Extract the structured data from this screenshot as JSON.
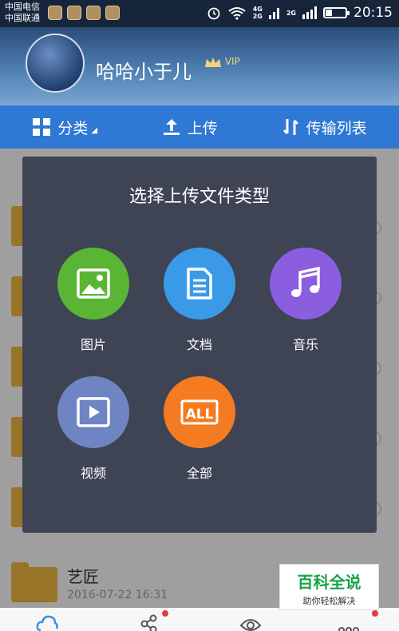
{
  "status": {
    "carrier1": "中国电信",
    "carrier2": "中国联通",
    "net1": "4G",
    "net2": "2G",
    "net3": "2G",
    "time": "20:15"
  },
  "header": {
    "username": "哈哈小于儿",
    "vip": "VIP"
  },
  "tabs": {
    "category": "分类",
    "upload": "上传",
    "transfer": "传输列表"
  },
  "list": {
    "rows": [
      {
        "name": "艺匠",
        "date": "2016-07-22  16:31"
      }
    ]
  },
  "dialog": {
    "title": "选择上传文件类型",
    "options": [
      {
        "label": "图片",
        "color": "#5ab535",
        "icon": "image-icon"
      },
      {
        "label": "文档",
        "color": "#3b9ae8",
        "icon": "document-icon"
      },
      {
        "label": "音乐",
        "color": "#8b5ee0",
        "icon": "music-icon"
      },
      {
        "label": "视频",
        "color": "#6f84c2",
        "icon": "video-icon"
      },
      {
        "label": "全部",
        "color": "#f57b22",
        "icon": "all-icon",
        "icon_text": "ALL"
      }
    ]
  },
  "watermark": {
    "title": "百科全说",
    "subtitle": "助你轻松解决"
  }
}
